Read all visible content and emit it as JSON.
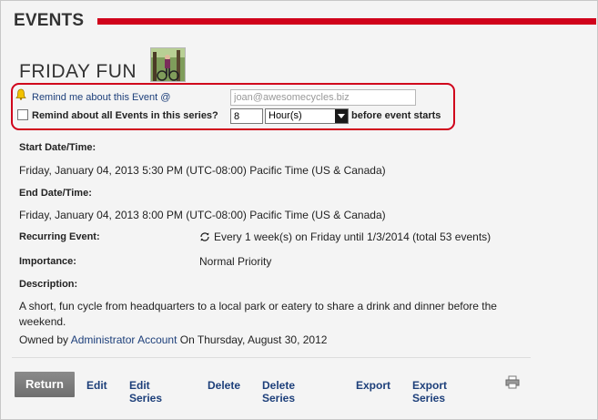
{
  "header": {
    "title": "EVENTS"
  },
  "event": {
    "title": "FRIDAY FUN"
  },
  "reminder": {
    "remind_label": "Remind me about this Event @",
    "email_value": "joan@awesomecycles.biz",
    "series_label": "Remind about all Events in this series?",
    "amount_value": "8",
    "unit_value": "Hour(s)",
    "before_label": "before event starts"
  },
  "details": {
    "start_label": "Start Date/Time:",
    "start_value": "Friday, January 04, 2013 5:30 PM (UTC-08:00) Pacific Time (US & Canada)",
    "end_label": "End Date/Time:",
    "end_value": "Friday, January 04, 2013 8:00 PM (UTC-08:00) Pacific Time (US & Canada)",
    "recurring_label": "Recurring Event:",
    "recurring_value": "Every 1 week(s) on Friday until 1/3/2014 (total 53 events)",
    "importance_label": "Importance:",
    "importance_value": "Normal Priority",
    "description_label": "Description:",
    "description_value": "A short, fun cycle from headquarters to a local park or eatery to share a drink and dinner before the weekend.",
    "owned_prefix": "Owned by",
    "owner_name": "Administrator Account",
    "owned_suffix": "On Thursday, August 30, 2012"
  },
  "toolbar": {
    "return": "Return",
    "edit": "Edit",
    "edit_series": "Edit Series",
    "delete": "Delete",
    "delete_series": "Delete Series",
    "export": "Export",
    "export_series": "Export Series"
  },
  "colors": {
    "accent": "#d0021b",
    "link": "#1d3f7a"
  }
}
